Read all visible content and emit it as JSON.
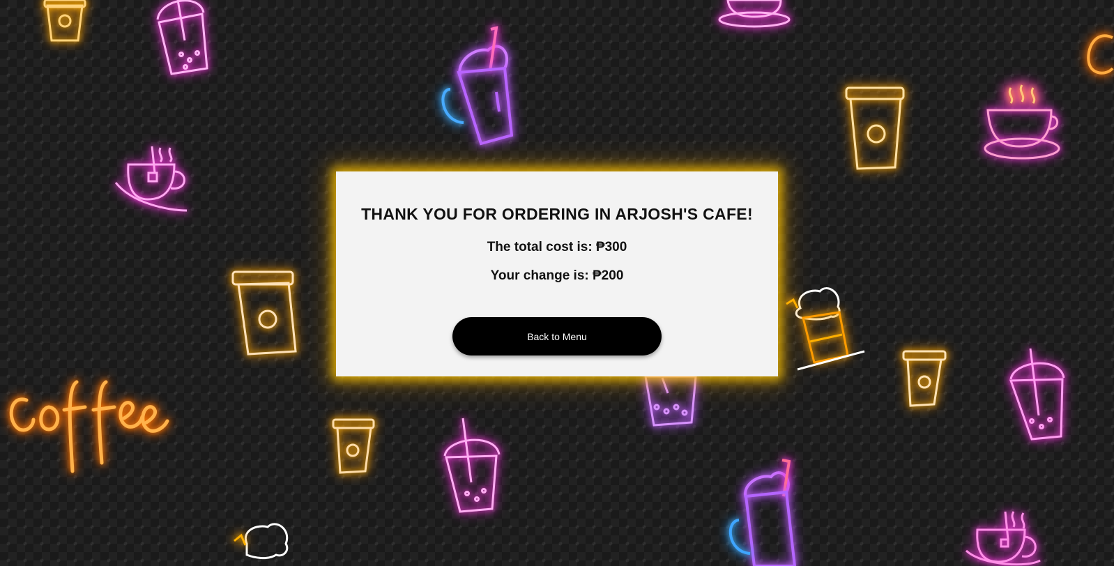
{
  "card": {
    "title": "THANK YOU FOR ORDERING IN ARJOSH'S CAFE!",
    "total_cost_label": "The total cost is: ₱300",
    "change_label": "Your change is: ₱200",
    "back_button_label": "Back to Menu"
  },
  "background": {
    "neon_text": "coffee",
    "icons": [
      "coffee-cup-icon",
      "boba-cup-icon",
      "milkshake-icon",
      "tea-cup-icon",
      "frappe-icon",
      "coffee-sign-icon"
    ],
    "colors": {
      "orange": "#ff7a00",
      "pink": "#ff3fe0",
      "gold": "#ffb300",
      "violet": "#c86bff",
      "cyan": "#49b8ff",
      "card_glow": "#ffc800"
    }
  }
}
